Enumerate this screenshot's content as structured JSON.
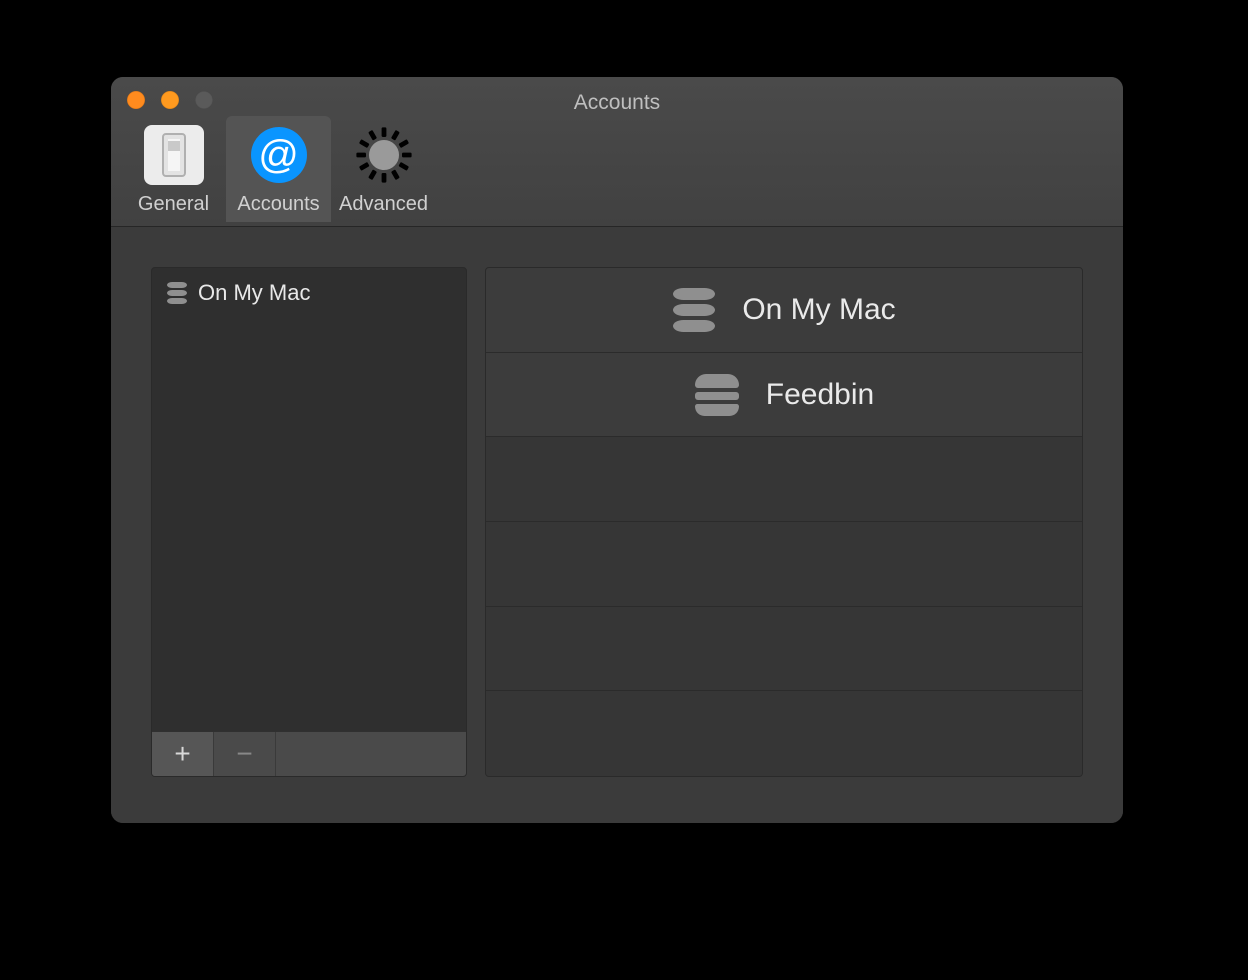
{
  "window": {
    "title": "Accounts"
  },
  "toolbar": {
    "items": [
      {
        "id": "general",
        "label": "General"
      },
      {
        "id": "accounts",
        "label": "Accounts"
      },
      {
        "id": "advanced",
        "label": "Advanced"
      }
    ],
    "active": "accounts"
  },
  "sidebar": {
    "accounts": [
      {
        "label": "On My Mac",
        "icon": "database-icon"
      }
    ],
    "buttons": {
      "add": "+",
      "remove": "−"
    }
  },
  "account_types": [
    {
      "label": "On My Mac",
      "icon": "database-icon"
    },
    {
      "label": "Feedbin",
      "icon": "feedbin-icon"
    },
    {
      "label": "",
      "icon": ""
    },
    {
      "label": "",
      "icon": ""
    },
    {
      "label": "",
      "icon": ""
    },
    {
      "label": "",
      "icon": ""
    }
  ]
}
